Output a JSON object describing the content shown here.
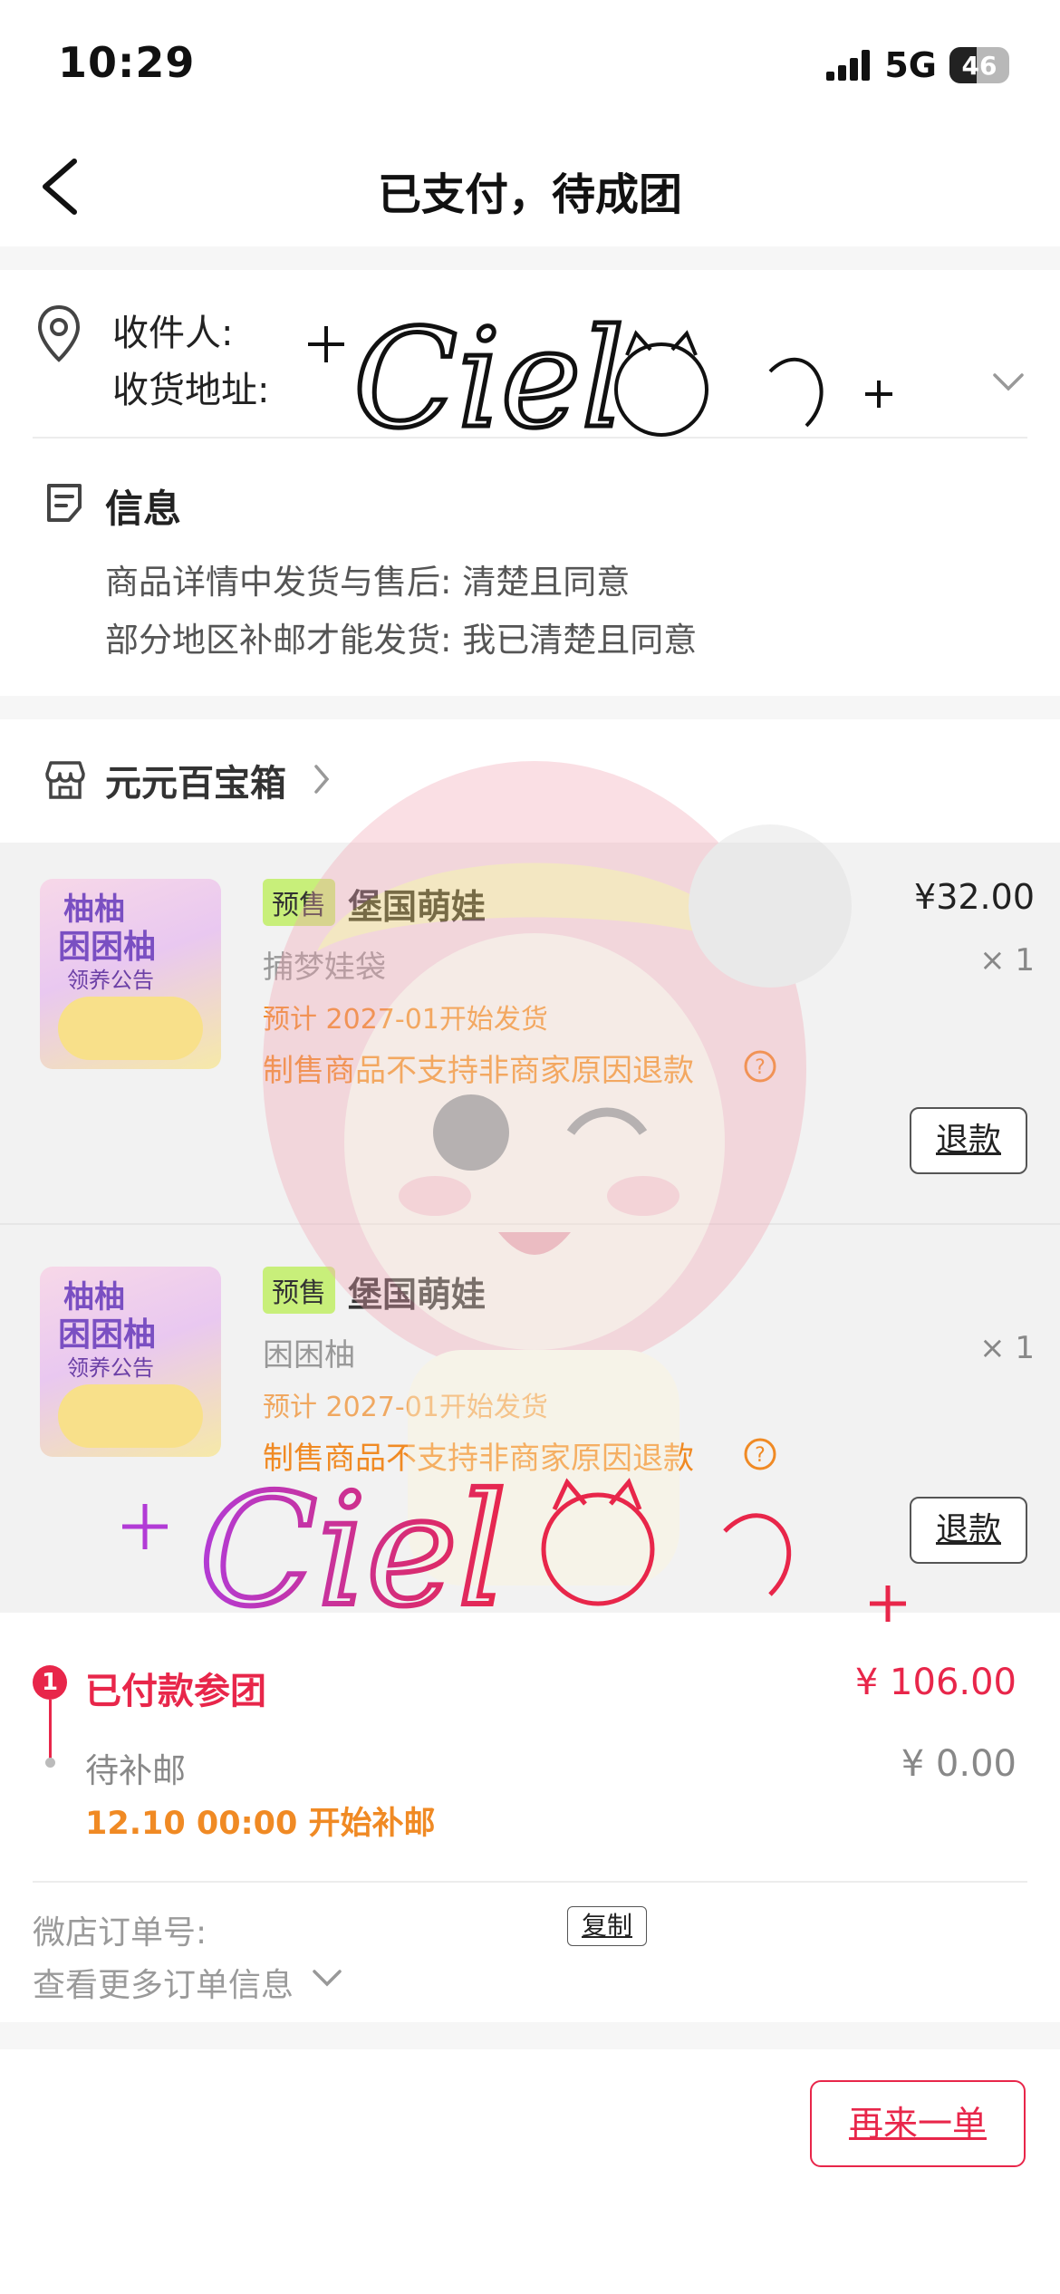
{
  "status_bar": {
    "time": "10:29",
    "network": "5G",
    "battery": "46"
  },
  "nav": {
    "title": "已支付，待成团"
  },
  "address": {
    "recipient_label": "收件人:",
    "address_label": "收货地址:"
  },
  "info": {
    "title": "信息",
    "lines": [
      "商品详情中发货与售后: 清楚且同意",
      "部分地区补邮才能发货: 我已清楚且同意"
    ]
  },
  "shop": {
    "name": "元元百宝箱"
  },
  "products": [
    {
      "tag": "预售",
      "name": "堡国萌娃",
      "variant": "捕梦娃袋",
      "ship_note": "预计 2027-01开始发货",
      "refund_note": "制售商品不支持非商家原因退款",
      "price": "¥32.00",
      "qty": "× 1",
      "refund_button": "退款",
      "thumb_text_1": "柚柚",
      "thumb_text_2": "困困柚",
      "thumb_text_3": "领养公告"
    },
    {
      "tag": "预售",
      "name": "堡国萌娃",
      "variant": "困困柚",
      "ship_note": "预计 2027-01开始发货",
      "refund_note": "制售商品不支持非商家原因退款",
      "price": "",
      "qty": "× 1",
      "refund_button": "退款",
      "thumb_text_1": "柚柚",
      "thumb_text_2": "困困柚",
      "thumb_text_3": "领养公告"
    }
  ],
  "payment": {
    "step_number": "1",
    "paid_label": "已付款参团",
    "paid_amount": "¥ 106.00",
    "pending_label": "待补邮",
    "pending_amount": "¥ 0.00",
    "pending_note": "12.10 00:00 开始补邮"
  },
  "order": {
    "order_no_label": "微店订单号:",
    "copy_button": "复制",
    "more_info": "查看更多订单信息"
  },
  "footer": {
    "reorder_button": "再来一单"
  },
  "watermark": {
    "text": "Ciel"
  },
  "colors": {
    "accent_red": "#e8264a",
    "orange": "#f08a24",
    "tag_green": "#c8ef7a"
  }
}
